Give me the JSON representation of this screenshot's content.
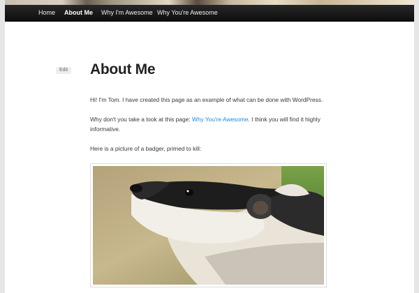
{
  "nav": {
    "items": [
      {
        "label": "Home"
      },
      {
        "label": "About Me"
      },
      {
        "label": "Why I'm Awesome"
      },
      {
        "label": "Why You're Awesome"
      }
    ],
    "active_index": 1
  },
  "post": {
    "edit_label": "Edit",
    "title": "About Me",
    "p1": "Hi! I'm Tom. I have created this page as an example of what can be done with WordPress.",
    "p2_before": "Why don't you take a look at this page: ",
    "p2_link": "Why You're Awesome",
    "p2_after": ". I think you will find it highly informative.",
    "p3": "Here is a picture of a badger, primed to kill:"
  },
  "colors": {
    "link": "#1b8be0",
    "nav_bg": "#1a1a1a",
    "title": "#222222"
  }
}
